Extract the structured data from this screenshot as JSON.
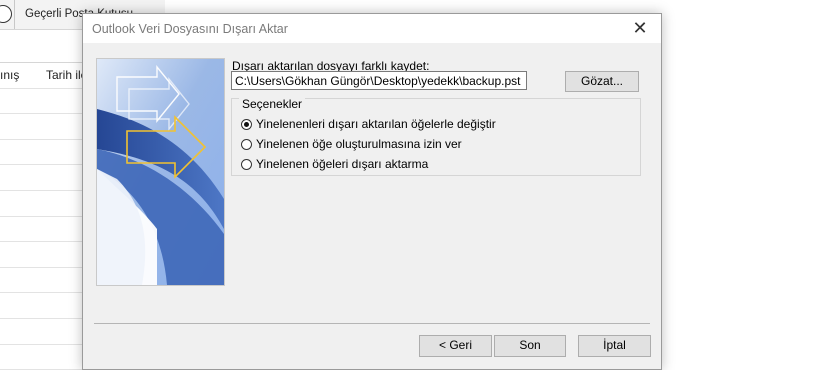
{
  "background": {
    "scope_label": "Geçerli Posta Kutusu",
    "col1_label": "ınış",
    "col2_label": "Tarih ile"
  },
  "dialog": {
    "title": "Outlook Veri Dosyasını Dışarı Aktar",
    "close_glyph": "✕",
    "save_as_label": "Dışarı aktarılan dosyayı farklı kaydet:",
    "path_value": "C:\\Users\\Gökhan Güngör\\Desktop\\yedekk\\backup.pst",
    "browse_label": "Gözat...",
    "options_legend": "Seçenekler",
    "options": [
      {
        "label": "Yinelenenleri dışarı aktarılan öğelerle değiştir",
        "selected": true
      },
      {
        "label": "Yinelenen öğe oluşturulmasına izin ver",
        "selected": false
      },
      {
        "label": "Yinelenen öğeleri dışarı aktarma",
        "selected": false
      }
    ],
    "back_label": "< Geri",
    "finish_label": "Son",
    "cancel_label": "İptal"
  },
  "colors": {
    "banner_light": "#c5d8f4",
    "banner_dark": "#2b4f9e",
    "arrow_yellow": "#f2c230"
  }
}
